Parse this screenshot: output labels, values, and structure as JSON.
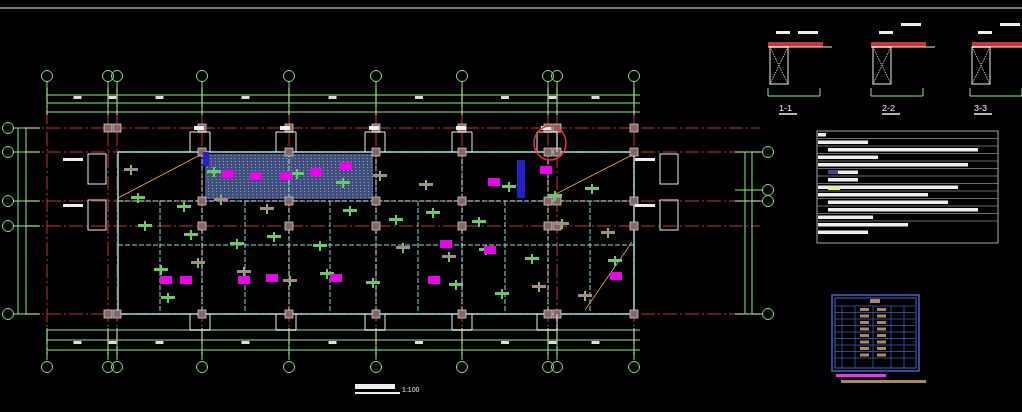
{
  "drawing": {
    "section_labels": [
      {
        "label": "1-1"
      },
      {
        "label": "2-2"
      },
      {
        "label": "3-3"
      }
    ],
    "scale_label": "1:100"
  }
}
